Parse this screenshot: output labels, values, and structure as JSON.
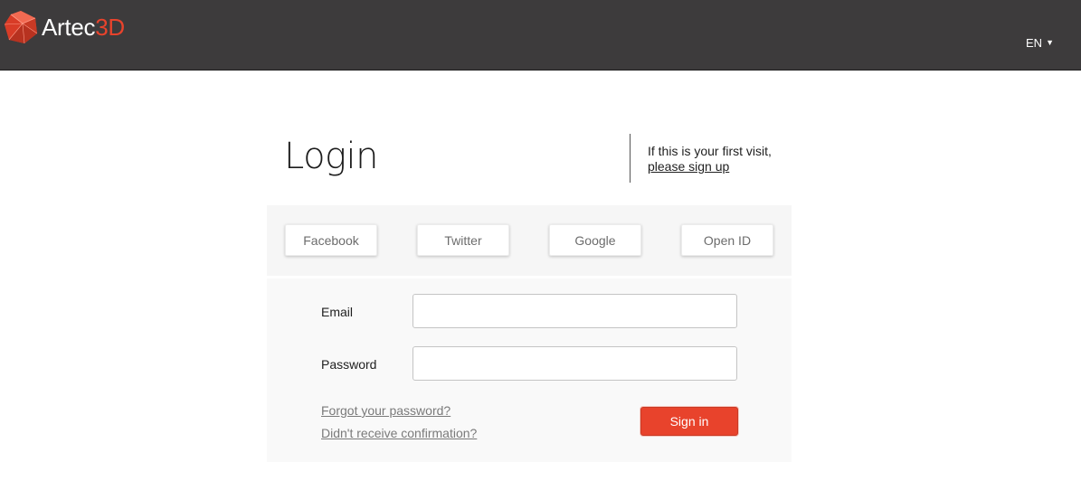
{
  "header": {
    "logo_word": "Artec",
    "logo_accent": "3D",
    "language": "EN",
    "language_caret_icon": "caret-down-icon"
  },
  "login": {
    "title": "Login",
    "first_visit_text": "If this is your first visit,",
    "signup_link": "please sign up"
  },
  "social": {
    "buttons": [
      "Facebook",
      "Twitter",
      "Google",
      "Open ID"
    ]
  },
  "form": {
    "email_label": "Email",
    "email_value": "",
    "password_label": "Password",
    "password_value": "",
    "forgot_link": "Forgot your password?",
    "confirm_link": "Didn't receive confirmation?",
    "signin_label": "Sign in"
  },
  "colors": {
    "header_bg": "#3d3b3c",
    "accent": "#e8432c",
    "panel_bg": "#f6f6f6"
  }
}
